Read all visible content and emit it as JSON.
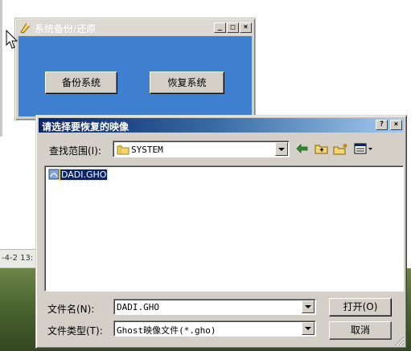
{
  "backdrop": {
    "taskbar_time_text": "-4-2 13:"
  },
  "backup_window": {
    "title": "系统备份/还原",
    "backup_button": "备份系统",
    "restore_button": "恢复系统",
    "client_color": "#3f7fcf"
  },
  "dialog": {
    "title": "请选择要恢复的映像",
    "look_in_label": "查找范围(I):",
    "look_in_value": "SYSTEM",
    "files": [
      {
        "name": "DADI.GHO",
        "selected": true
      }
    ],
    "filename_label": "文件名(N):",
    "filename_value": "DADI.GHO",
    "filetype_label": "文件类型(T):",
    "filetype_value": "Ghost映像文件(*.gho)",
    "open_button": "打开(O)",
    "cancel_button": "取消",
    "title_bar_color": "#0a246a"
  },
  "icons": [
    "cursor-arrow-icon",
    "app-icon",
    "minimize-icon",
    "maximize-icon",
    "close-icon",
    "help-icon",
    "folder-icon",
    "back-arrow-icon",
    "up-folder-icon",
    "new-folder-icon",
    "view-menu-icon",
    "ghost-file-icon",
    "dropdown-arrow-icon",
    "resize-grip-icon"
  ]
}
